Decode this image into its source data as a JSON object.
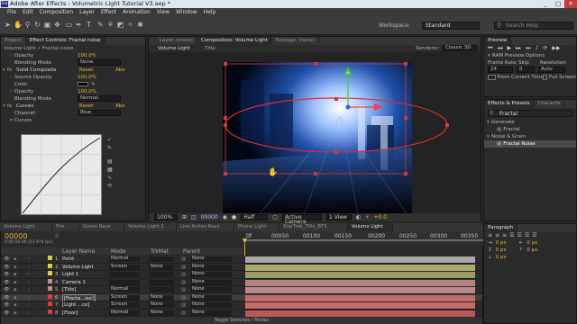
{
  "window": {
    "title": "Adobe After Effects - Volumetric Light Tutorial V3.aep *",
    "app_icon": "Ae",
    "minimize": "_",
    "maximize": "□",
    "close": "✕"
  },
  "menu": [
    "File",
    "Edit",
    "Composition",
    "Layer",
    "Effect",
    "Animation",
    "View",
    "Window",
    "Help"
  ],
  "toolbar": {
    "workspace_label": "Workspace:",
    "workspace_value": "Standard",
    "search_placeholder": "Search Help",
    "tools": [
      "selection-tool",
      "hand-tool",
      "zoom-tool",
      "rotate-tool",
      "camera-tool",
      "pan-behind-tool",
      "rectangle-tool",
      "pen-tool",
      "text-tool",
      "brush-tool",
      "clone-tool",
      "eraser-tool",
      "roto-tool",
      "puppet-tool"
    ]
  },
  "effects": {
    "tab_project": "Project",
    "tab_controls": "Effect Controls: Fractal noise",
    "subtitle": "Volume Light • Fractal noise",
    "rows": [
      {
        "label": "Opacity",
        "value": "100.0%"
      },
      {
        "label": "Blending Mode",
        "value": "None"
      },
      {
        "label": "Solid Composite",
        "value": "Reset",
        "about": "Abo"
      },
      {
        "label": "Source Opacity",
        "value": "100.0%"
      },
      {
        "label": "Color",
        "value": ""
      },
      {
        "label": "Opacity",
        "value": "100.0%"
      },
      {
        "label": "Blending Mode",
        "value": "Normal"
      },
      {
        "label": "Curves",
        "value": "Reset",
        "about": "Abo"
      },
      {
        "label": "Channel:",
        "value": "Blue"
      },
      {
        "label": "Curves",
        "value": ""
      }
    ]
  },
  "comp": {
    "tab_layer": "Layer: (none)",
    "tab_comp": "Composition: Volume Light",
    "tab_footage": "Footage: (none)",
    "crumb1": "Volume Light",
    "crumb2": "Title",
    "renderer": "Renderer:",
    "renderer_value": "Classic 3D",
    "zoom": "100%",
    "timecode": "00000",
    "resolution": "Half",
    "view": "Active Camera",
    "views": "1 View",
    "exposure": "+0.0"
  },
  "preview": {
    "title": "Preview",
    "ram_options": "RAM Preview Options",
    "frame_rate_label": "Frame Rate",
    "skip_label": "Skip",
    "resolution_label": "Resolution",
    "frame_rate": "24",
    "skip": "0",
    "resolution": "Auto",
    "from_current": "From Current Time",
    "full_screen": "Full Screen"
  },
  "effects_presets": {
    "tab1": "Effects & Presets",
    "tab2": "Characte",
    "search": "Fractal",
    "items": [
      {
        "label": "Generate",
        "indent": 0
      },
      {
        "label": "Fractal",
        "indent": 1
      },
      {
        "label": "Noise & Grain",
        "indent": 0
      },
      {
        "label": "Fractal Noise",
        "indent": 1
      }
    ]
  },
  "paragraph": {
    "title": "Paragraph",
    "v1": "0 px",
    "v2": "0 px",
    "v3": "0 px",
    "v4": "0 px",
    "v5": "0 px"
  },
  "timeline": {
    "tabs": [
      "Volume Light",
      "Fire",
      "Green Rays",
      "Volume Light 2",
      "Live Action Rays",
      "Phone Light",
      "StarTrek_Title_BTS",
      "Volume Light"
    ],
    "timecode": "00000",
    "timecode_sub": "0:00:00:00 (23.976 fps)",
    "col_name": "Layer Name",
    "col_mode": "Mode",
    "col_trkmat": "TrkMat",
    "col_parent": "Parent",
    "ruler": [
      "0f",
      "00050",
      "00100",
      "00150",
      "00200",
      "00250",
      "00300",
      "00350"
    ],
    "footer": "Toggle Switches / Modes",
    "layers": [
      {
        "num": "1",
        "name": "Point",
        "mode": "Normal",
        "trkmat": "",
        "parent": "None",
        "color": "#d8d23a",
        "bar": "#a8a8a8"
      },
      {
        "num": "2",
        "name": "Volume Light",
        "mode": "Screen",
        "trkmat": "None",
        "parent": "None",
        "color": "#d8d23a",
        "bar": "#a9a971"
      },
      {
        "num": "3",
        "name": "Light 1",
        "mode": "",
        "trkmat": "",
        "parent": "None",
        "color": "#d8d23a",
        "bar": "#9c9c66"
      },
      {
        "num": "4",
        "name": "Camera 1",
        "mode": "",
        "trkmat": "",
        "parent": "None",
        "color": "#c98a8a",
        "bar": "#b48484"
      },
      {
        "num": "5",
        "name": "[Title]",
        "mode": "Normal",
        "trkmat": "",
        "parent": "None",
        "color": "#c98a8a",
        "bar": "#b68b8b"
      },
      {
        "num": "6",
        "name": "[Fracta...ise]",
        "mode": "Screen",
        "trkmat": "None",
        "parent": "None",
        "color": "#e23a3a",
        "bar": "#c46a6a"
      },
      {
        "num": "7",
        "name": "[Light ...ce]",
        "mode": "Screen",
        "trkmat": "None",
        "parent": "None",
        "color": "#e23a3a",
        "bar": "#c46a6a"
      },
      {
        "num": "8",
        "name": "[Floor]",
        "mode": "Normal",
        "trkmat": "None",
        "parent": "None",
        "color": "#e23a3a",
        "bar": "#b85858"
      }
    ]
  }
}
